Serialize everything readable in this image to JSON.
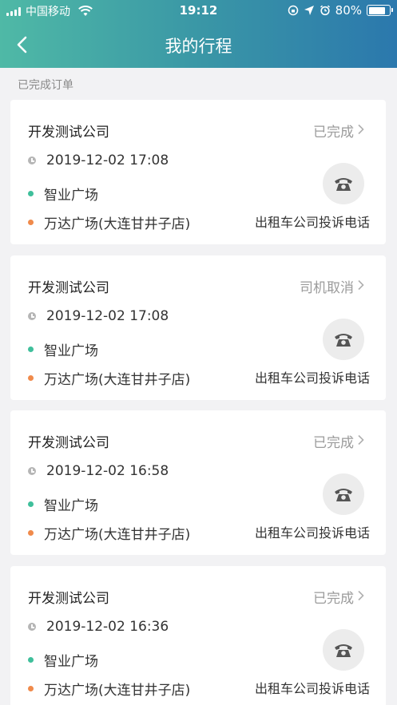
{
  "status_bar": {
    "carrier": "中国移动",
    "time": "19:12",
    "battery": "80%",
    "battery_level": 0.8
  },
  "nav": {
    "title": "我的行程",
    "back_icon": "chevron-left-icon"
  },
  "section_label": "已完成订单",
  "trips": [
    {
      "company": "开发测试公司",
      "status": "已完成",
      "datetime": "2019-12-02 17:08",
      "start": "智业广场",
      "end": "万达广场(大连甘井子店)",
      "complaint_label": "出租车公司投诉电话"
    },
    {
      "company": "开发测试公司",
      "status": "司机取消",
      "datetime": "2019-12-02 17:08",
      "start": "智业广场",
      "end": "万达广场(大连甘井子店)",
      "complaint_label": "出租车公司投诉电话"
    },
    {
      "company": "开发测试公司",
      "status": "已完成",
      "datetime": "2019-12-02 16:58",
      "start": "智业广场",
      "end": "万达广场(大连甘井子店)",
      "complaint_label": "出租车公司投诉电话"
    },
    {
      "company": "开发测试公司",
      "status": "已完成",
      "datetime": "2019-12-02 16:36",
      "start": "智业广场",
      "end": "万达广场(大连甘井子店)",
      "complaint_label": "出租车公司投诉电话"
    }
  ],
  "colors": {
    "header_start": "#4fb9a6",
    "header_end": "#2b78ad",
    "start_dot": "#3fbf9b",
    "end_dot": "#f08a4b"
  }
}
